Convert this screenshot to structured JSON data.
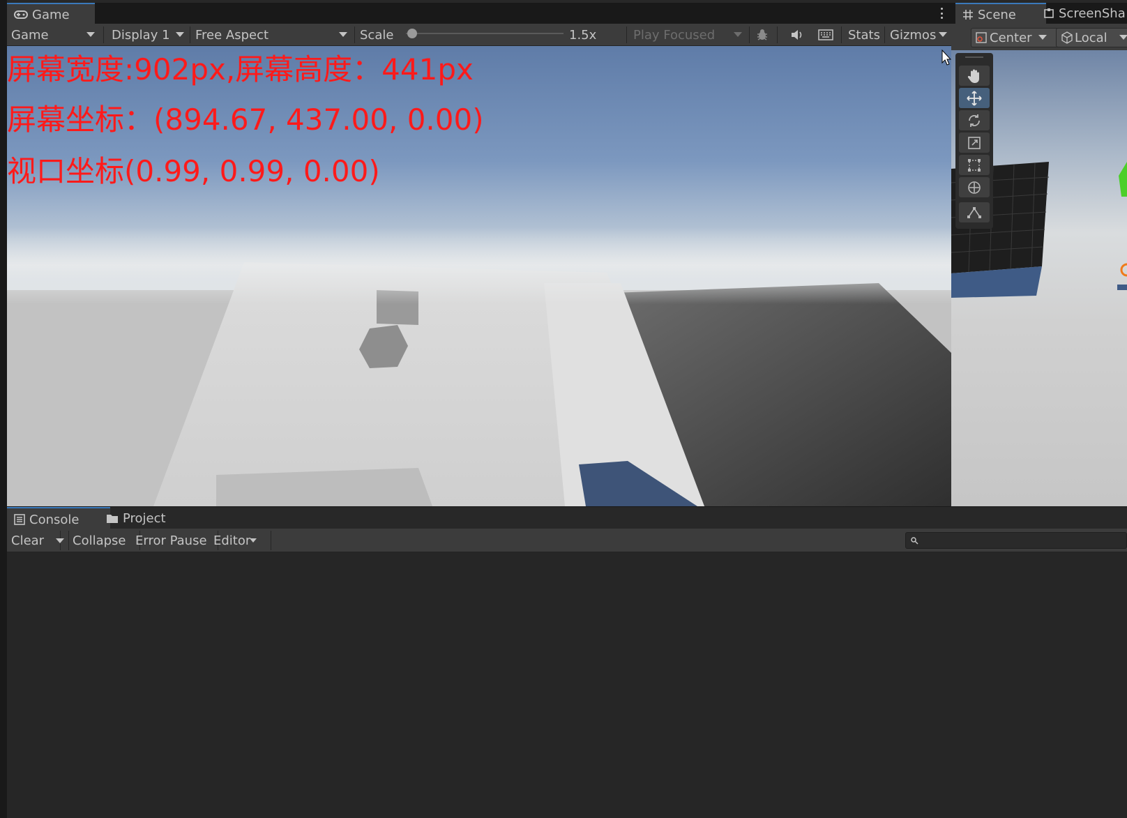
{
  "game": {
    "tab_label": "Game",
    "toolbar": {
      "mode": "Game",
      "display": "Display 1",
      "aspect": "Free Aspect",
      "scale_label": "Scale",
      "scale_value": "1.5x",
      "scale_fraction": 0.0,
      "play_mode": "Play Focused",
      "stats": "Stats",
      "gizmos": "Gizmos"
    },
    "overlay": {
      "line1": "屏幕宽度:902px,屏幕高度：441px",
      "line2": "屏幕坐标：(894.67, 437.00, 0.00)",
      "line3": "视口坐标(0.99, 0.99, 0.00)"
    }
  },
  "scene": {
    "tab_label": "Scene",
    "tab2_label": "ScreenSha",
    "pivot": "Center",
    "space": "Local",
    "tools": [
      "hand-tool",
      "move-tool",
      "rotate-tool",
      "scale-tool",
      "rect-tool",
      "transform-tool",
      "custom-tool"
    ],
    "active_tool": "move-tool"
  },
  "console": {
    "tab_label": "Console",
    "project_tab_label": "Project",
    "clear": "Clear",
    "collapse": "Collapse",
    "error_pause": "Error Pause",
    "editor": "Editor",
    "search_placeholder": ""
  },
  "colors": {
    "overlay_text": "#ff1a1a",
    "active_tab_accent": "#3a79bb",
    "editor_bg": "#282828"
  }
}
